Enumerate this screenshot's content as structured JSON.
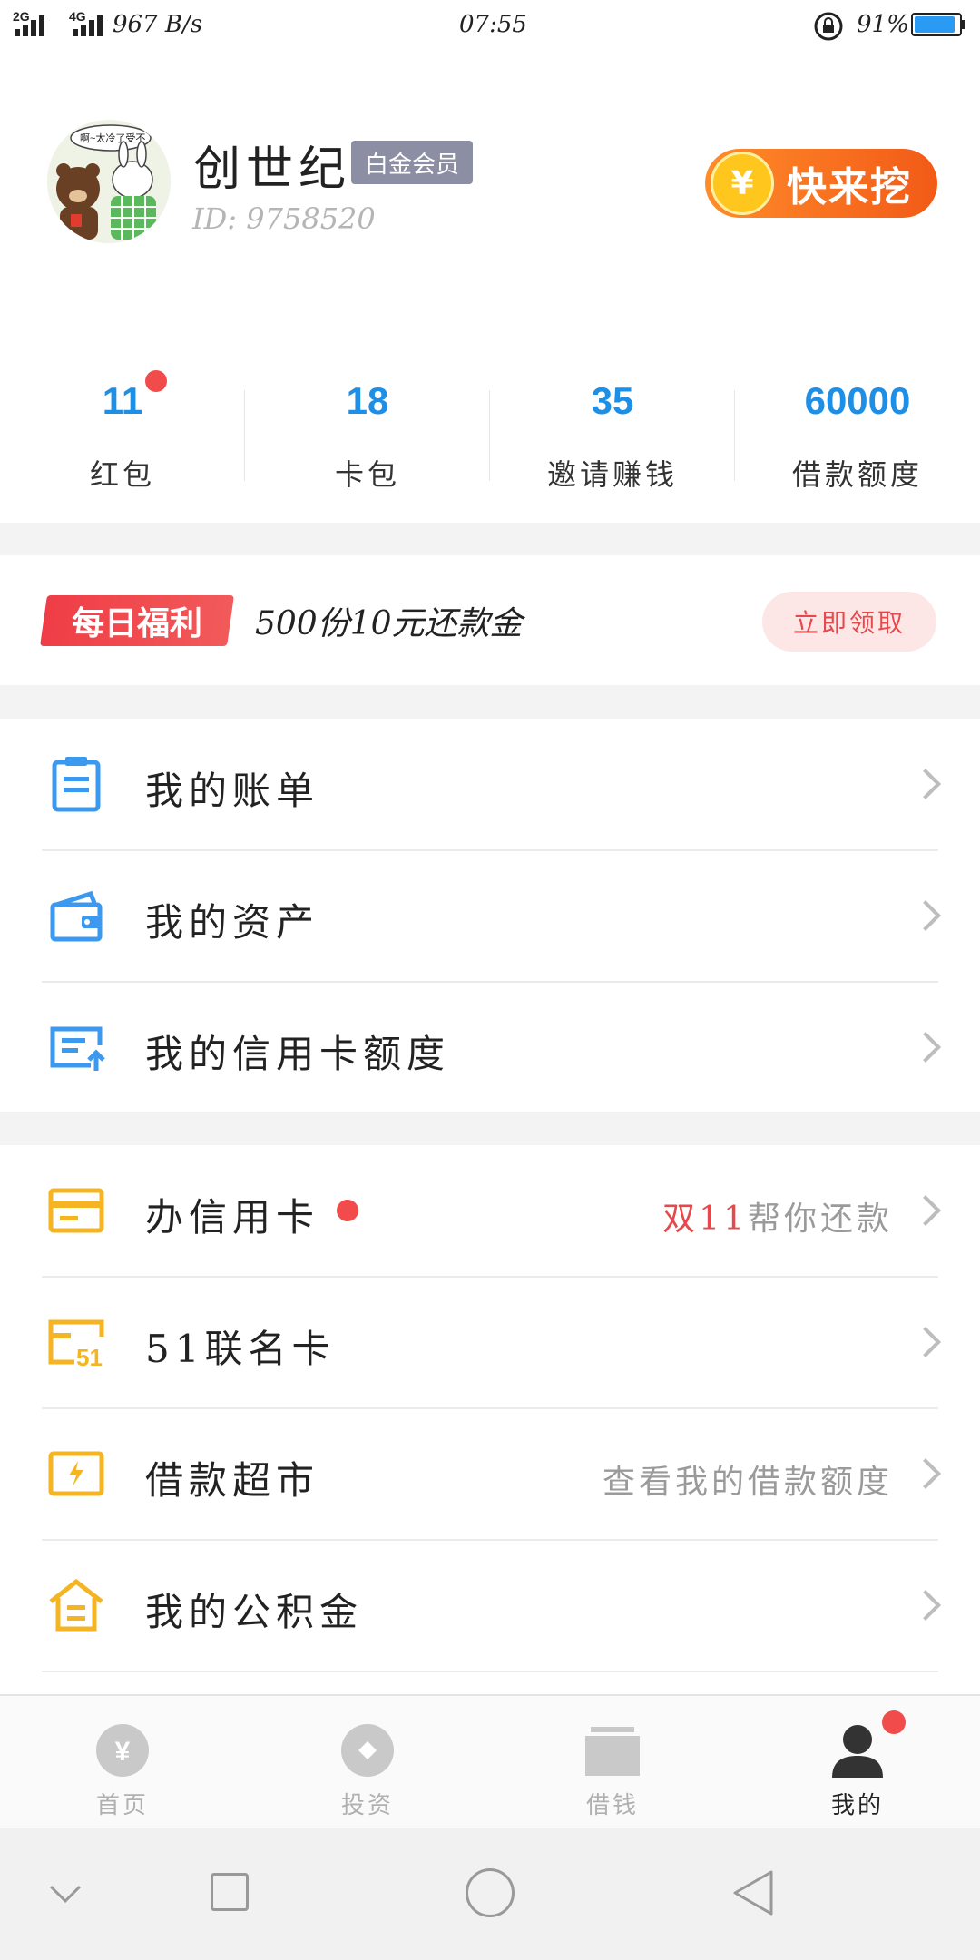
{
  "status_bar": {
    "network_2g": "2G",
    "network_4g": "4G",
    "speed": "967 B/s",
    "time": "07:55",
    "battery_percent": "91%",
    "battery_level": 0.91
  },
  "profile": {
    "avatar_caption": "啊~太冷了受不",
    "username": "创世纪",
    "member_badge": "白金会员",
    "user_id": "ID: 9758520",
    "dig_button_label": "快来挖",
    "dig_button_coin": "¥"
  },
  "stats": [
    {
      "value": "11",
      "label": "红包",
      "has_dot": true
    },
    {
      "value": "18",
      "label": "卡包",
      "has_dot": false
    },
    {
      "value": "35",
      "label": "邀请赚钱",
      "has_dot": false
    },
    {
      "value": "60000",
      "label": "借款额度",
      "has_dot": false
    }
  ],
  "welfare": {
    "tag": "每日福利",
    "text": "500份10元还款金",
    "button": "立即领取"
  },
  "menu_group_1": [
    {
      "label": "我的账单",
      "icon": "bill-icon"
    },
    {
      "label": "我的资产",
      "icon": "wallet-icon"
    },
    {
      "label": "我的信用卡额度",
      "icon": "credit-limit-icon"
    }
  ],
  "menu_group_2": [
    {
      "label": "办信用卡",
      "icon": "credit-card-icon",
      "right_highlight": "双11",
      "right_text": "帮你还款",
      "has_dot": true
    },
    {
      "label": "51联名卡",
      "icon": "co-brand-card-icon",
      "right_highlight": "",
      "right_text": "",
      "has_dot": false
    },
    {
      "label": "借款超市",
      "icon": "loan-market-icon",
      "right_highlight": "",
      "right_text": "查看我的借款额度",
      "has_dot": false
    },
    {
      "label": "我的公积金",
      "icon": "housing-fund-icon",
      "right_highlight": "",
      "right_text": "",
      "has_dot": false
    }
  ],
  "tabbar": [
    {
      "label": "首页",
      "icon": "home-yen-icon",
      "active": false
    },
    {
      "label": "投资",
      "icon": "invest-icon",
      "active": false
    },
    {
      "label": "借钱",
      "icon": "borrow-icon",
      "active": false
    },
    {
      "label": "我的",
      "icon": "profile-icon",
      "active": true,
      "has_dot": true
    }
  ],
  "colors": {
    "accent_blue": "#1e8fe6",
    "accent_yellow": "#f5b523",
    "red": "#f24b4b",
    "orange": "#f25a17"
  }
}
